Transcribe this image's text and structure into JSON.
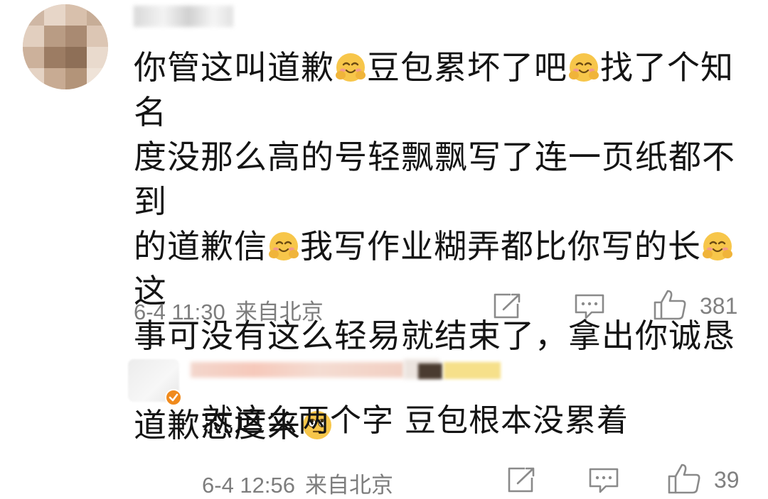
{
  "comment": {
    "segments": [
      {
        "text": "你管这叫道歉"
      },
      {
        "emoji": "hug-emoji"
      },
      {
        "text": "豆包累坏了吧"
      },
      {
        "emoji": "hug-emoji"
      },
      {
        "text": "找了个知名度没那么高的号轻飘飘写了连一页纸都不到的道歉信"
      },
      {
        "emoji": "hug-emoji"
      },
      {
        "text": "我写作业糊弄都比你写的长"
      },
      {
        "emoji": "hug-emoji"
      },
      {
        "text": "这事可没有这么轻易就结束了，拿出你诚恳的道歉态度来"
      },
      {
        "emoji": "eye-roll-emoji"
      }
    ],
    "line1": "你管这叫道歉",
    "line1b": "豆包累坏了吧",
    "line1c": "找了个知名",
    "line2": "度没那么高的号轻飘飘写了连一页纸都不到",
    "line3a": "的道歉信",
    "line3b": "我写作业糊弄都比你写的长",
    "line3c": "这",
    "line4": "事可没有这么轻易就结束了，拿出你诚恳的",
    "line5": "道歉态度来",
    "time": "6-4 11:30",
    "location": "来自北京",
    "like_count": "381"
  },
  "reply": {
    "text": "就这么两个字 豆包根本没累着",
    "time": "6-4 12:56",
    "location": "来自北京",
    "like_count": "39"
  },
  "icons": {
    "share": "share-icon",
    "comment": "comment-icon",
    "like": "thumbs-up-icon",
    "verified": "verified-badge-icon"
  },
  "colors": {
    "meta_text": "#7d7d7d",
    "emoji_yellow": "#f7c64a",
    "verified_orange": "#f08a1c"
  }
}
